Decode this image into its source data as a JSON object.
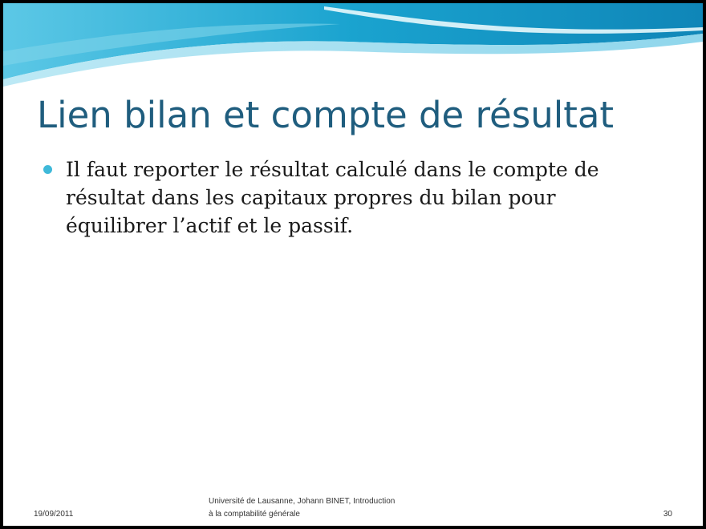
{
  "slide": {
    "title": "Lien bilan et compte de résultat",
    "bullets": [
      "Il faut reporter le résultat calculé dans le compte de résultat dans les capitaux propres du bilan pour équilibrer l’actif et le passif."
    ],
    "footer": {
      "date": "19/09/2011",
      "center_line1": "Université de Lausanne, Johann BINET, Introduction",
      "center_line2": "à la comptabilité générale",
      "page_number": "30"
    }
  },
  "colors": {
    "title": "#1f5d7e",
    "bullet": "#3fb9d9",
    "wave_dark": "#1497c4",
    "wave_light": "#7fd3ea"
  }
}
